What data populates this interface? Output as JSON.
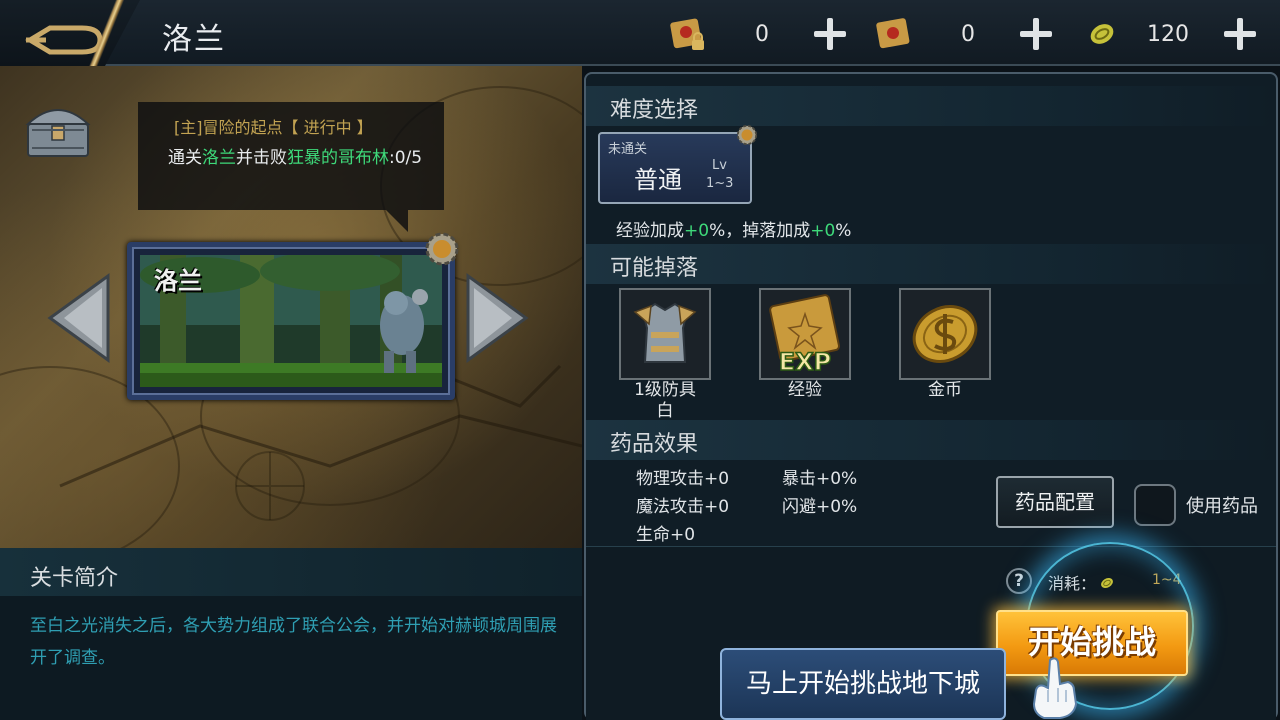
{
  "header": {
    "title": "洛兰",
    "resources": [
      {
        "icon": "locked-scroll-icon",
        "value": "0"
      },
      {
        "icon": "scroll-icon",
        "value": "0"
      },
      {
        "icon": "coin-icon",
        "value": "120"
      }
    ]
  },
  "quest": {
    "title": "[主]冒险的起点【 进行中 】",
    "desc_parts": [
      "通关",
      "洛兰",
      "并击败",
      "狂暴的哥布林",
      ":0/5"
    ]
  },
  "stage": {
    "name": "洛兰"
  },
  "intro": {
    "title": "关卡简介",
    "text": "至白之光消失之后，各大势力组成了联合公会，并开始对赫顿城周围展开了调查。"
  },
  "difficulty": {
    "section_title": "难度选择",
    "status": "未通关",
    "name": "普通",
    "lv_label": "Lv",
    "lv_range": "1~3",
    "bonus_parts": [
      "经验加成",
      "+0",
      "%，掉落加成",
      "+0",
      "%"
    ]
  },
  "drops": {
    "section_title": "可能掉落",
    "items": [
      {
        "icon": "armor-icon",
        "label_line1": "1级防具",
        "label_line2": "白"
      },
      {
        "icon": "exp-scroll-icon",
        "label_line1": "经验",
        "label_line2": ""
      },
      {
        "icon": "gold-coin-icon",
        "label_line1": "金币",
        "label_line2": ""
      }
    ],
    "exp_text": "EXP"
  },
  "potion": {
    "section_title": "药品效果",
    "stats": {
      "physical_attack": "物理攻击+0",
      "critical": "暴击+0%",
      "magic_attack": "魔法攻击+0",
      "dodge": "闪避+0%",
      "hp": "生命+0"
    },
    "config_label": "药品配置",
    "use_label": "使用药品"
  },
  "cost": {
    "help_icon_text": "?",
    "label": "消耗：",
    "value": "1~4"
  },
  "start_button": "开始挑战",
  "guide_tip": "马上开始挑战地下城",
  "colors": {
    "accent_gold": "#c7a650",
    "highlight_green": "#3ed97a",
    "intro_text": "#2f9fb3",
    "start_orange": "#f39a12"
  }
}
